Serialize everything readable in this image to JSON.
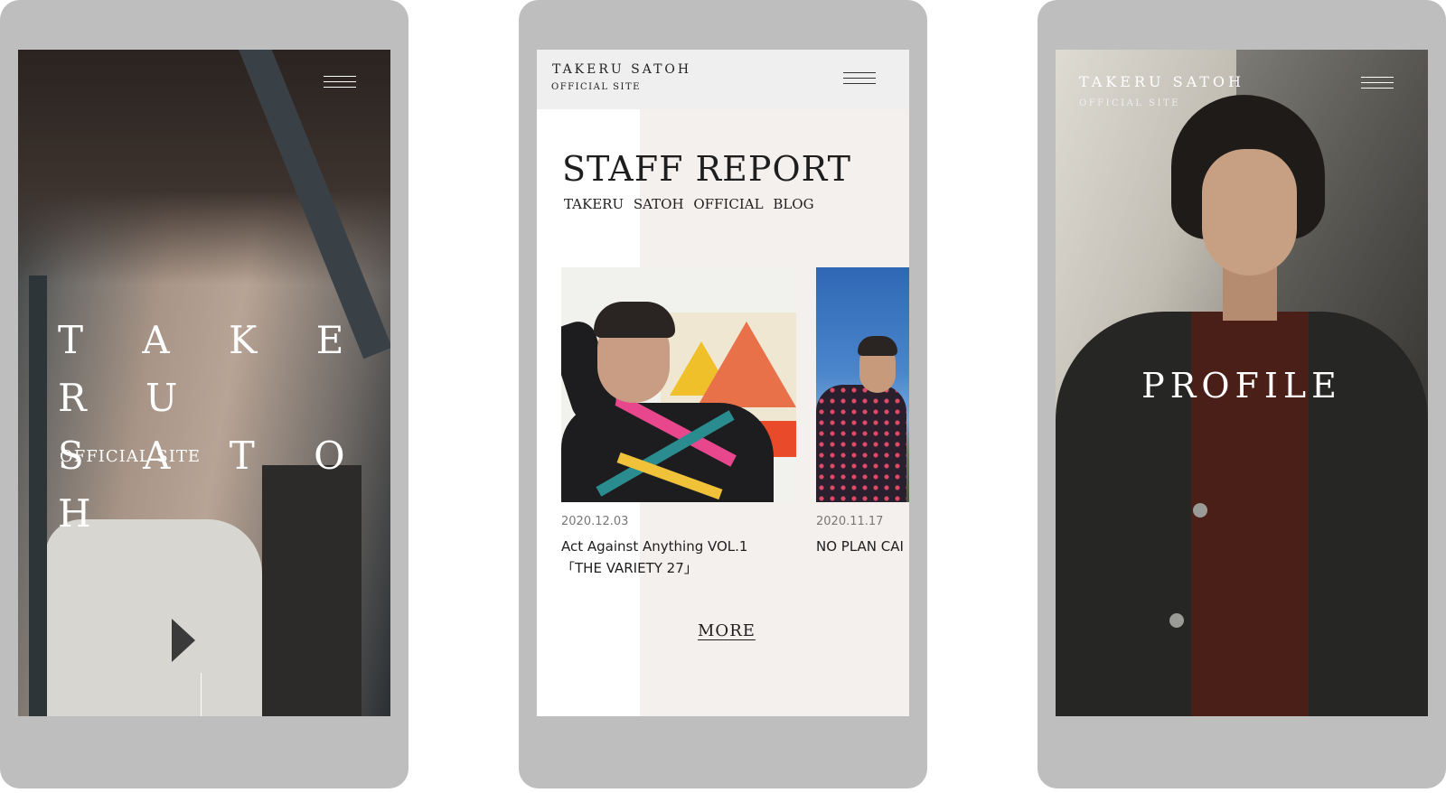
{
  "phones": {
    "home": {
      "hero_title": "T A K E R U\nS A T O H",
      "hero_subtitle": "OFFICIAL SITE",
      "menu_icon": "hamburger-icon"
    },
    "blog": {
      "logo_title": "TAKERU SATOH",
      "logo_subtitle": "OFFICIAL SITE",
      "menu_icon": "hamburger-icon",
      "section_title": "STAFF REPORT",
      "section_subtitle": "TAKERU SATOH OFFICIAL BLOG",
      "posts": [
        {
          "date": "2020.12.03",
          "title": "Act Against Anything VOL.1\n「THE VARIETY 27」"
        },
        {
          "date": "2020.11.17",
          "title": "NO PLAN CAI"
        }
      ],
      "more_label": "MORE"
    },
    "profile": {
      "logo_title": "TAKERU SATOH",
      "logo_subtitle": "OFFICIAL SITE",
      "menu_icon": "hamburger-icon",
      "page_title": "PROFILE"
    }
  },
  "colors": {
    "phone_frame": "#bebebe",
    "blog_header_bg": "#efefef",
    "blog_panel_bg": "#f4f0ee",
    "text_dark": "#1e1e1e",
    "date_gray": "#777777"
  }
}
